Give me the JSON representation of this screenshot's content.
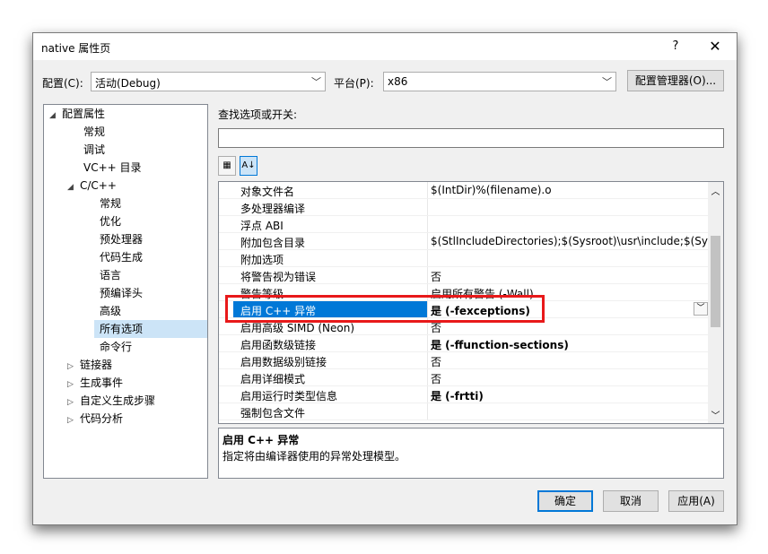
{
  "window": {
    "title": "native 属性页",
    "help": "?",
    "close": "✕"
  },
  "config": {
    "label": "配置(C):",
    "value": "活动(Debug)"
  },
  "platform": {
    "label": "平台(P):",
    "value": "x86"
  },
  "config_manager_label": "配置管理器(O)...",
  "tree": [
    {
      "label": "配置属性",
      "toggle": "◢"
    },
    {
      "label": "常规",
      "toggle": ""
    },
    {
      "label": "调试",
      "toggle": ""
    },
    {
      "label": "VC++ 目录",
      "toggle": ""
    },
    {
      "label": "C/C++",
      "toggle": "◢"
    },
    {
      "label": "常规",
      "toggle": ""
    },
    {
      "label": "优化",
      "toggle": ""
    },
    {
      "label": "预处理器",
      "toggle": ""
    },
    {
      "label": "代码生成",
      "toggle": ""
    },
    {
      "label": "语言",
      "toggle": ""
    },
    {
      "label": "预编译头",
      "toggle": ""
    },
    {
      "label": "高级",
      "toggle": ""
    },
    {
      "label": "所有选项",
      "toggle": ""
    },
    {
      "label": "命令行",
      "toggle": ""
    },
    {
      "label": "链接器",
      "toggle": "▷"
    },
    {
      "label": "生成事件",
      "toggle": "▷"
    },
    {
      "label": "自定义生成步骤",
      "toggle": "▷"
    },
    {
      "label": "代码分析",
      "toggle": "▷"
    }
  ],
  "search": {
    "label": "查找选项或开关:",
    "value": ""
  },
  "toolbar": {
    "categorized_icon": "▦",
    "alpha_icon": "A↓"
  },
  "properties": [
    {
      "name": "对象文件名",
      "value": "$(IntDir)%(filename).o"
    },
    {
      "name": "多处理器编译",
      "value": ""
    },
    {
      "name": "浮点 ABI",
      "value": ""
    },
    {
      "name": "附加包含目录",
      "value": "$(StlIncludeDirectories);$(Sysroot)\\usr\\include;$(Sysrc"
    },
    {
      "name": "附加选项",
      "value": ""
    },
    {
      "name": "将警告视为错误",
      "value": "否"
    },
    {
      "name": "警告等级",
      "value": "启用所有警告 (-Wall)"
    },
    {
      "name": "启用 C++ 异常",
      "value": "是 (-fexceptions)"
    },
    {
      "name": "启用高级 SIMD (Neon)",
      "value": "否"
    },
    {
      "name": "启用函数级链接",
      "value": "是 (-ffunction-sections)"
    },
    {
      "name": "启用数据级别链接",
      "value": "否"
    },
    {
      "name": "启用详细模式",
      "value": "否"
    },
    {
      "name": "启用运行时类型信息",
      "value": "是 (-frtti)"
    },
    {
      "name": "强制包含文件",
      "value": ""
    }
  ],
  "description": {
    "title": "启用 C++ 异常",
    "text": "指定将由编译器使用的异常处理模型。"
  },
  "buttons": {
    "ok": "确定",
    "cancel": "取消",
    "apply": "应用(A)"
  }
}
